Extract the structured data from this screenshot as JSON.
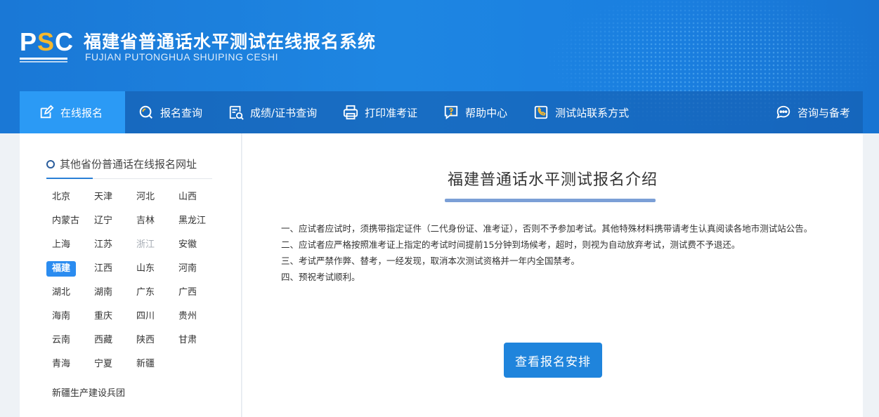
{
  "header": {
    "logo_text_p": "P",
    "logo_text_s": "S",
    "logo_text_c": "C",
    "title": "福建省普通话水平测试在线报名系统",
    "subtitle": "FUJIAN PUTONGHUA SHUIPING CESHI"
  },
  "nav": {
    "items": [
      {
        "label": "在线报名",
        "icon": "edit-icon",
        "active": true
      },
      {
        "label": "报名查询",
        "icon": "search-icon"
      },
      {
        "label": "成绩/证书查询",
        "icon": "certificate-search-icon"
      },
      {
        "label": "打印准考证",
        "icon": "printer-icon"
      },
      {
        "label": "帮助中心",
        "icon": "help-icon"
      },
      {
        "label": "测试站联系方式",
        "icon": "phone-icon"
      }
    ],
    "right": {
      "label": "咨询与备考",
      "icon": "chat-icon"
    }
  },
  "sidebar": {
    "title": "其他省份普通话在线报名网址",
    "provinces": [
      "北京",
      "天津",
      "河北",
      "山西",
      "内蒙古",
      "辽宁",
      "吉林",
      "黑龙江",
      "上海",
      "江苏",
      "浙江",
      "安徽",
      "福建",
      "江西",
      "山东",
      "河南",
      "湖北",
      "湖南",
      "广东",
      "广西",
      "海南",
      "重庆",
      "四川",
      "贵州",
      "云南",
      "西藏",
      "陕西",
      "甘肃",
      "青海",
      "宁夏",
      "新疆"
    ],
    "selected": "福建",
    "disabled": [
      "浙江"
    ],
    "extra": "新疆生产建设兵团"
  },
  "main": {
    "title": "福建普通话水平测试报名介绍",
    "paragraphs": [
      "一、应试者应试时，须携带指定证件（二代身份证、准考证），否则不予参加考试。其他特殊材料携带请考生认真阅读各地市测试站公告。",
      "二、应试者应严格按照准考证上指定的考试时间提前15分钟到场候考，超时，则视为自动放弃考试，测试费不予退还。",
      "三、考试严禁作弊、替考，一经发现，取消本次测试资格并一年内全国禁考。",
      "四、预祝考试顺利。"
    ],
    "button_label": "查看报名安排"
  },
  "colors": {
    "header_blue": "#1e86e2",
    "nav_active": "#2b9af5",
    "selected_province": "#2b8cf0",
    "button": "#1f84dc",
    "logo_accent": "#f5b82e"
  }
}
